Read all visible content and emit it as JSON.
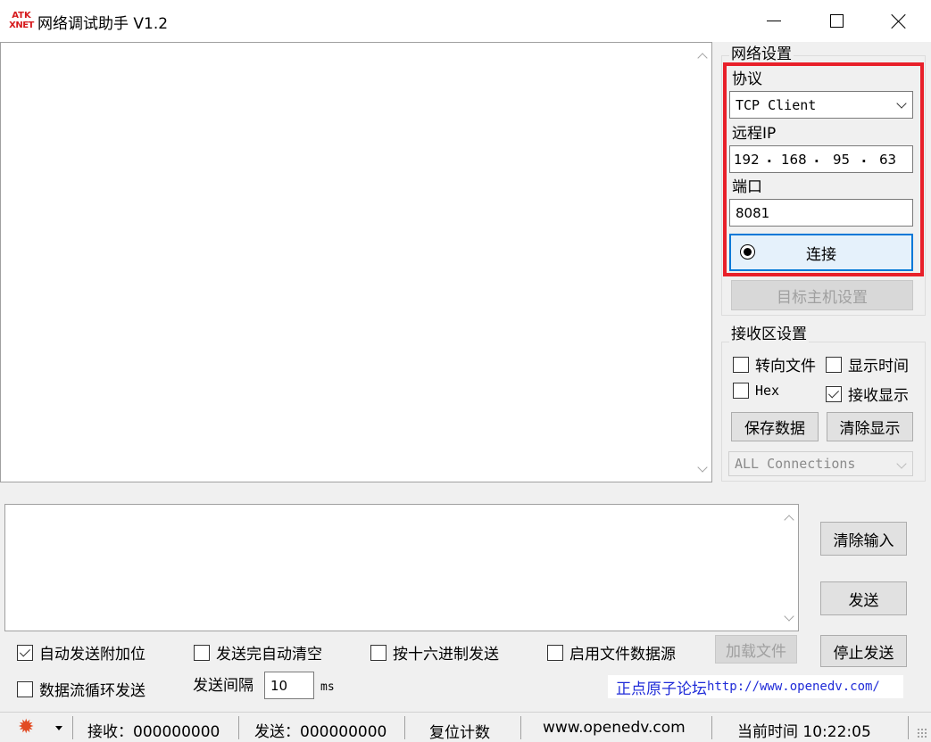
{
  "titlebar": {
    "logo_top": "ATK",
    "logo_bottom": "XNET",
    "title": "网络调试助手 V1.2"
  },
  "network": {
    "group_title": "网络设置",
    "protocol_label": "协议",
    "protocol_value": "TCP Client",
    "remote_ip_label": "远程IP",
    "ip": [
      "192",
      "168",
      "95",
      "63"
    ],
    "port_label": "端口",
    "port_value": "8081",
    "connect_button": "连接",
    "target_host_button": "目标主机设置"
  },
  "receive": {
    "group_title": "接收区设置",
    "redirect_file": "转向文件",
    "show_time": "显示时间",
    "hex": "Hex",
    "show_receive": "接收显示",
    "save_data": "保存数据",
    "clear_display": "清除显示",
    "connections_dropdown": "ALL Connections"
  },
  "send": {
    "clear_input": "清除输入",
    "send_button": "发送",
    "stop_send": "停止发送",
    "load_file": "加载文件",
    "auto_append": "自动发送附加位",
    "auto_clear": "发送完自动清空",
    "hex_send": "按十六进制发送",
    "file_source": "启用文件数据源",
    "loop_send": "数据流循环发送",
    "interval_label": "发送间隔",
    "interval_value": "10",
    "interval_unit": "ms"
  },
  "link": {
    "text": "正点原子论坛",
    "url": "http://www.openedv.com/"
  },
  "statusbar": {
    "received": "接收：000000000",
    "sent": "发送：000000000",
    "reset_count": "复位计数",
    "website": "www.openedv.com",
    "current_time": "当前时间 10:22:05"
  },
  "colors": {
    "highlight": "#e8202a",
    "connect_border": "#0078d7",
    "link": "#1f2bd8"
  }
}
